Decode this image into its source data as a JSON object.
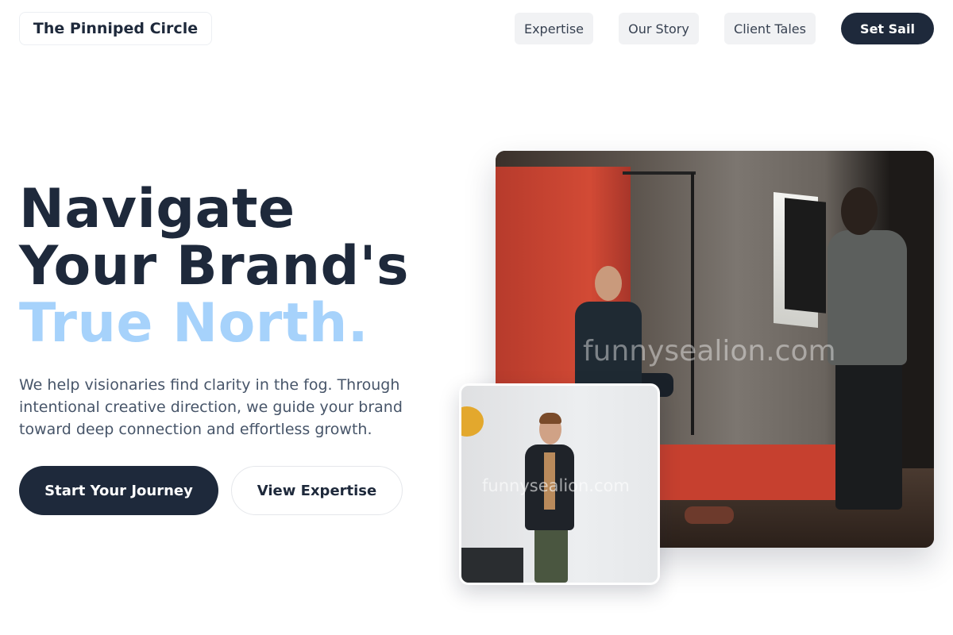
{
  "nav": {
    "brand": "The Pinniped Circle",
    "links": [
      "Expertise",
      "Our Story",
      "Client Tales"
    ],
    "cta": "Set Sail"
  },
  "hero": {
    "title_line1": "Navigate",
    "title_line2": "Your Brand's",
    "title_accent": "True North.",
    "description": "We help visionaries find clarity in the fog. Through intentional creative direction, we guide your brand toward deep connection and effortless growth.",
    "primary_button": "Start Your Journey",
    "secondary_button": "View Expertise"
  },
  "media": {
    "watermark": "funnysealion.com",
    "colors": {
      "accent": "#a6d2fb",
      "dark": "#1e293b"
    }
  }
}
